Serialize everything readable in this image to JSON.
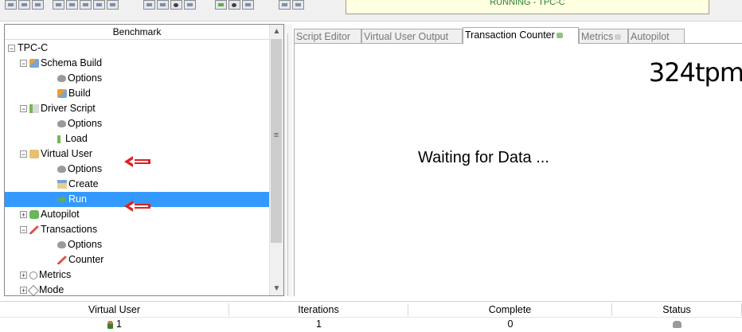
{
  "toolbar": {
    "status_banner": "RUNNING - TPC-C"
  },
  "tree": {
    "header": "Benchmark",
    "root": "TPC-C",
    "items": [
      {
        "label": "Schema Build",
        "icon": "schema-build-icon",
        "expander": "⊟"
      },
      {
        "label": "Options",
        "icon": "options-icon"
      },
      {
        "label": "Build",
        "icon": "build-icon"
      },
      {
        "label": "Driver Script",
        "icon": "driver-script-icon",
        "expander": "⊟"
      },
      {
        "label": "Options",
        "icon": "options-icon"
      },
      {
        "label": "Load",
        "icon": "load-icon"
      },
      {
        "label": "Virtual User",
        "icon": "virtual-user-icon",
        "expander": "⊟"
      },
      {
        "label": "Options",
        "icon": "options-icon"
      },
      {
        "label": "Create",
        "icon": "create-icon"
      },
      {
        "label": "Run",
        "icon": "run-icon",
        "selected": true
      },
      {
        "label": "Autopilot",
        "icon": "autopilot-icon",
        "expander": "⊞"
      },
      {
        "label": "Transactions",
        "icon": "transactions-icon",
        "expander": "⊟"
      },
      {
        "label": "Options",
        "icon": "options-icon"
      },
      {
        "label": "Counter",
        "icon": "counter-icon"
      },
      {
        "label": "Metrics",
        "icon": "metrics-icon",
        "expander": "⊞"
      },
      {
        "label": "Mode",
        "icon": "mode-icon",
        "expander": "⊞"
      }
    ],
    "selection_color": "#3399ff"
  },
  "tabs": [
    {
      "label": "Script Editor",
      "active": false
    },
    {
      "label": "Virtual User Output",
      "active": false
    },
    {
      "label": "Transaction Counter",
      "active": true
    },
    {
      "label": "Metrics",
      "active": false
    },
    {
      "label": "Autopilot",
      "active": false
    }
  ],
  "counter": {
    "value": "324",
    "unit": "tpm",
    "waiting_message": "Waiting for Data ..."
  },
  "grid": {
    "headers": [
      "Virtual User",
      "Iterations",
      "Complete",
      "Status"
    ],
    "row": {
      "virtual_user": "1",
      "iterations": "1",
      "complete": "0"
    }
  },
  "annotations": {
    "arrow_color": "#e02020"
  }
}
